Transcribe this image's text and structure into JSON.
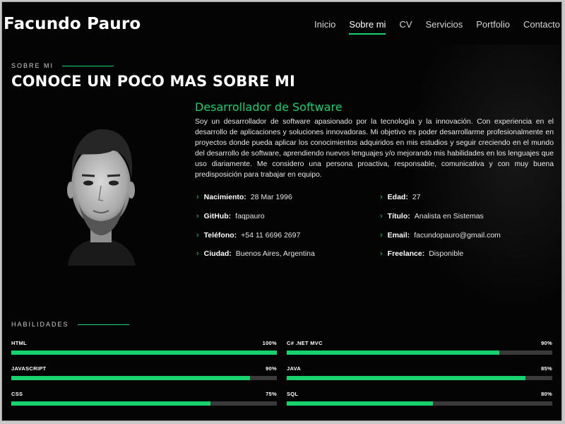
{
  "header": {
    "logo": "Facundo Pauro",
    "nav": [
      "Inicio",
      "Sobre mi",
      "CV",
      "Servicios",
      "Portfolio",
      "Contacto"
    ],
    "active": "Sobre mi"
  },
  "about": {
    "section_label": "SOBRE MI",
    "title": "CONOCE UN POCO MAS SOBRE MI",
    "role": "Desarrollador de Software",
    "bio": "Soy un desarrollador de software apasionado por la tecnología y la innovación. Con experiencia en el desarrollo de aplicaciones y soluciones innovadoras. Mi objetivo es poder desarrollarme profesionalmente en proyectos donde pueda aplicar los conocimientos adquiridos en mis estudios y seguir creciendo en el mundo del desarrollo de software, aprendiendo nuevos lenguajes y/o mejorando mis habilidades en los lenguajes que uso diariamente. Me considero una persona proactiva, responsable, comunicativa y con muy buena predisposición para trabajar en equipo.",
    "info_left": [
      {
        "label": "Nacimiento:",
        "value": "28 Mar 1996"
      },
      {
        "label": "GitHub:",
        "value": "faqpauro"
      },
      {
        "label": "Teléfono:",
        "value": "+54 11 6696 2697"
      },
      {
        "label": "Ciudad:",
        "value": "Buenos Aires, Argentina"
      }
    ],
    "info_right": [
      {
        "label": "Edad:",
        "value": "27"
      },
      {
        "label": "Título:",
        "value": "Analista en Sistemas"
      },
      {
        "label": "Email:",
        "value": "facundopauro@gmail.com"
      },
      {
        "label": "Freelance:",
        "value": "Disponible"
      }
    ]
  },
  "skills": {
    "section_label": "HABILIDADES",
    "items": [
      {
        "name": "HTML",
        "percent_label": "100%",
        "level": 100
      },
      {
        "name": "C# .NET MVC",
        "percent_label": "90%",
        "level": 80
      },
      {
        "name": "JAVASCRIPT",
        "percent_label": "90%",
        "level": 90
      },
      {
        "name": "JAVA",
        "percent_label": "85%",
        "level": 90
      },
      {
        "name": "CSS",
        "percent_label": "75%",
        "level": 75
      },
      {
        "name": "SQL",
        "percent_label": "80%",
        "level": 55
      }
    ]
  },
  "colors": {
    "accent": "#18d26e",
    "background": "#040404",
    "track": "#3a3a3a"
  }
}
